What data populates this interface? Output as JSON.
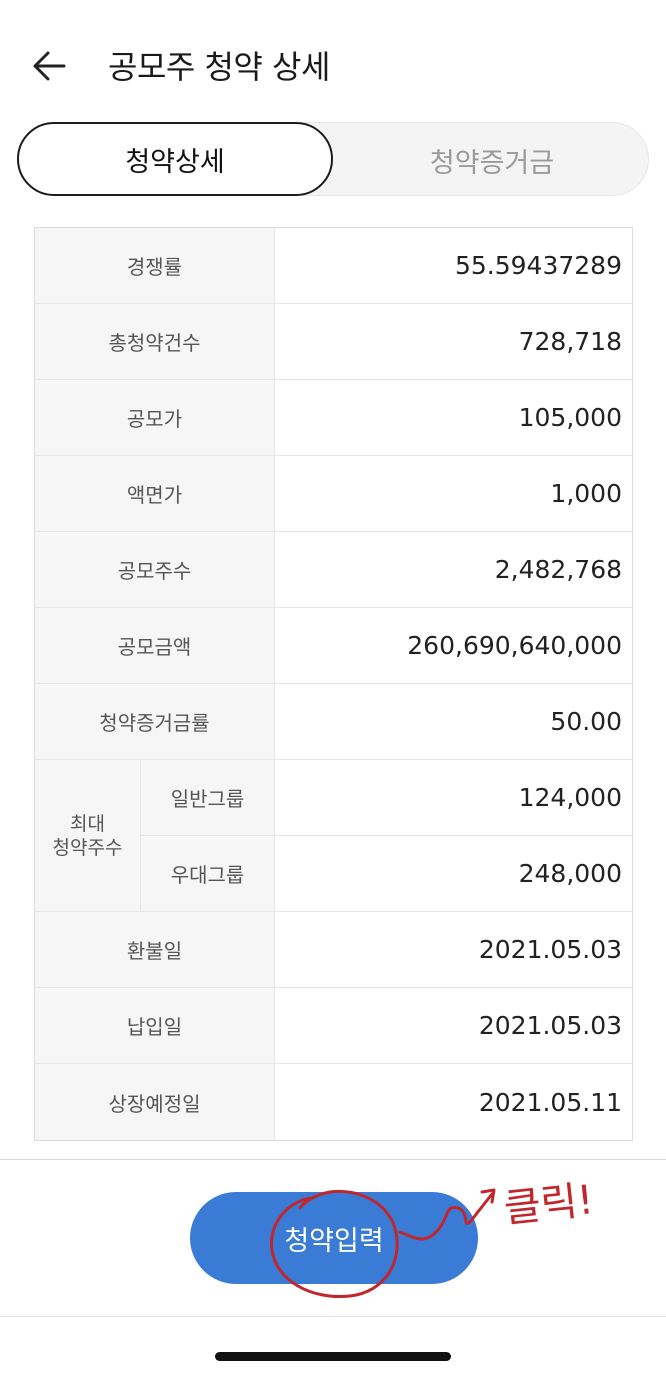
{
  "header": {
    "title": "공모주 청약 상세",
    "back_icon": "arrow-left-icon"
  },
  "tabs": [
    {
      "label": "청약상세",
      "active": true
    },
    {
      "label": "청약증거금",
      "active": false
    }
  ],
  "details": {
    "rows": [
      {
        "label": "경쟁률",
        "value": "55.59437289"
      },
      {
        "label": "총청약건수",
        "value": "728,718"
      },
      {
        "label": "공모가",
        "value": "105,000"
      },
      {
        "label": "액면가",
        "value": "1,000"
      },
      {
        "label": "공모주수",
        "value": "2,482,768"
      },
      {
        "label": "공모금액",
        "value": "260,690,640,000"
      },
      {
        "label": "청약증거금률",
        "value": "50.00"
      }
    ],
    "max_group": {
      "label_line1": "최대",
      "label_line2": "청약주수",
      "rows": [
        {
          "label": "일반그룹",
          "value": "124,000"
        },
        {
          "label": "우대그룹",
          "value": "248,000"
        }
      ]
    },
    "dates": [
      {
        "label": "환불일",
        "value": "2021.05.03"
      },
      {
        "label": "납입일",
        "value": "2021.05.03"
      },
      {
        "label": "상장예정일",
        "value": "2021.05.11"
      }
    ]
  },
  "submit": {
    "label": "청약입력"
  },
  "annotation": {
    "text": "클릭!",
    "color": "#c0262c"
  },
  "colors": {
    "primary": "#3a7bd5",
    "annotation": "#c0262c"
  }
}
